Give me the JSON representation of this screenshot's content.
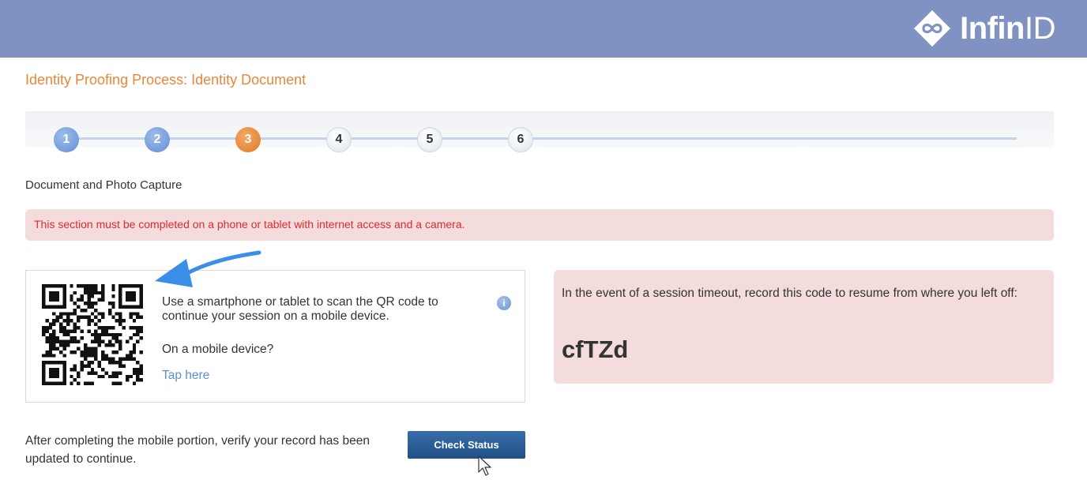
{
  "header": {
    "logo_text_bold": "Infin",
    "logo_text_light": "ID"
  },
  "page": {
    "title": "Identity Proofing Process: Identity Document",
    "section_label": "Document and Photo Capture"
  },
  "stepper": {
    "steps": [
      {
        "label": "1",
        "state": "done"
      },
      {
        "label": "2",
        "state": "done"
      },
      {
        "label": "3",
        "state": "current"
      },
      {
        "label": "4",
        "state": "todo"
      },
      {
        "label": "5",
        "state": "todo"
      },
      {
        "label": "6",
        "state": "todo"
      }
    ]
  },
  "alert": {
    "text": "This section must be completed on a phone or tablet with internet access and a camera."
  },
  "qr_panel": {
    "instruction": "Use a smartphone or tablet to scan the QR code to continue your session on a mobile device.",
    "mobile_question": "On a mobile device?",
    "tap_link": "Tap here"
  },
  "session": {
    "instruction": "In the event of a session timeout, record this code to resume from where you left off:",
    "code": "cfTZd"
  },
  "footer": {
    "verify_text": "After completing the mobile portion, verify your record has been updated to continue.",
    "check_status_label": "Check Status"
  },
  "colors": {
    "header_bg": "#7f92c2",
    "title_orange": "#e8873a",
    "alert_bg": "#f4dcdc",
    "alert_text": "#e02b2b",
    "link_blue": "#5a8fd0",
    "button_blue": "#1f4f86",
    "annotation_arrow": "#3b8ee8"
  },
  "icons": {
    "logo": "infinity-diamond-icon",
    "info": "info-icon",
    "qr": "qr-code",
    "annotation": "arrow-annotation-icon",
    "cursor": "mouse-pointer-icon"
  }
}
